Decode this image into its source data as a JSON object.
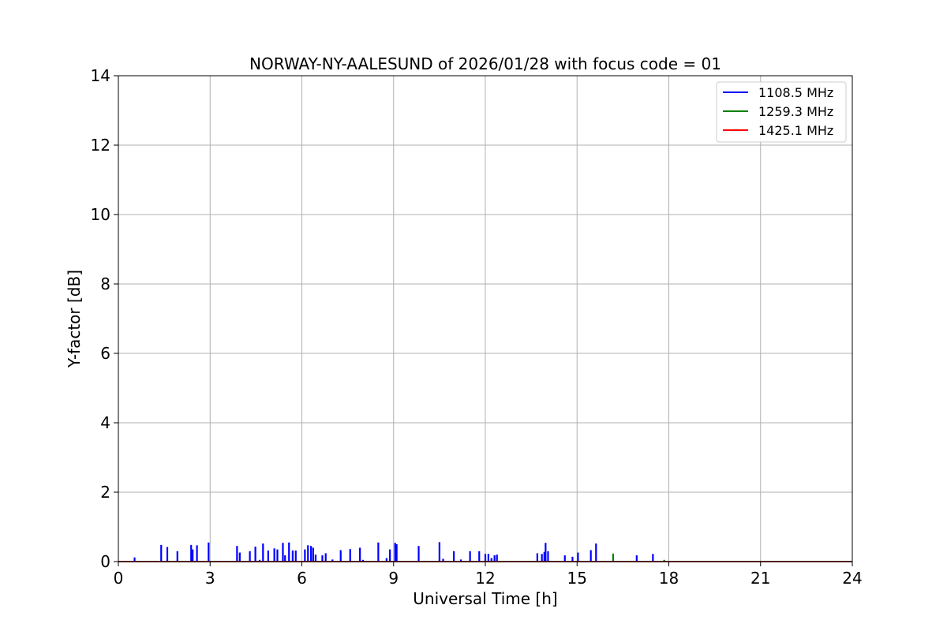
{
  "chart_data": {
    "type": "line",
    "title": "NORWAY-NY-AALESUND of 2026/01/28 with focus code = 01",
    "xlabel": "Universal Time [h]",
    "ylabel": "Y-factor [dB]",
    "xlim": [
      0,
      24
    ],
    "ylim": [
      0,
      14
    ],
    "xticks": [
      0,
      3,
      6,
      9,
      12,
      15,
      18,
      21,
      24
    ],
    "yticks": [
      0,
      2,
      4,
      6,
      8,
      10,
      12,
      14
    ],
    "grid": true,
    "legend_position": "top-right",
    "series": [
      {
        "name": "1108.5 MHz",
        "color": "#0000ff",
        "spikes": [
          [
            0.53,
            0.12
          ],
          [
            1.4,
            0.48
          ],
          [
            1.6,
            0.42
          ],
          [
            1.93,
            0.3
          ],
          [
            2.38,
            0.48
          ],
          [
            2.43,
            0.35
          ],
          [
            2.57,
            0.47
          ],
          [
            2.95,
            0.55
          ],
          [
            3.88,
            0.45
          ],
          [
            3.97,
            0.26
          ],
          [
            4.3,
            0.3
          ],
          [
            4.48,
            0.43
          ],
          [
            4.62,
            0.05
          ],
          [
            4.73,
            0.52
          ],
          [
            4.9,
            0.32
          ],
          [
            5.1,
            0.38
          ],
          [
            5.2,
            0.35
          ],
          [
            5.38,
            0.54
          ],
          [
            5.45,
            0.18
          ],
          [
            5.58,
            0.55
          ],
          [
            5.7,
            0.32
          ],
          [
            5.8,
            0.32
          ],
          [
            6.1,
            0.35
          ],
          [
            6.2,
            0.47
          ],
          [
            6.3,
            0.45
          ],
          [
            6.37,
            0.4
          ],
          [
            6.45,
            0.2
          ],
          [
            6.67,
            0.18
          ],
          [
            6.78,
            0.24
          ],
          [
            7.0,
            0.06
          ],
          [
            7.27,
            0.33
          ],
          [
            7.58,
            0.36
          ],
          [
            7.9,
            0.4
          ],
          [
            8.0,
            0.05
          ],
          [
            8.5,
            0.55
          ],
          [
            8.77,
            0.1
          ],
          [
            8.88,
            0.35
          ],
          [
            9.05,
            0.54
          ],
          [
            9.1,
            0.5
          ],
          [
            9.82,
            0.45
          ],
          [
            10.5,
            0.56
          ],
          [
            10.62,
            0.08
          ],
          [
            10.97,
            0.3
          ],
          [
            11.2,
            0.06
          ],
          [
            11.5,
            0.3
          ],
          [
            11.8,
            0.3
          ],
          [
            12.0,
            0.22
          ],
          [
            12.1,
            0.22
          ],
          [
            12.2,
            0.1
          ],
          [
            12.3,
            0.18
          ],
          [
            12.38,
            0.2
          ],
          [
            13.7,
            0.24
          ],
          [
            13.85,
            0.22
          ],
          [
            13.93,
            0.28
          ],
          [
            13.97,
            0.54
          ],
          [
            14.05,
            0.3
          ],
          [
            14.6,
            0.18
          ],
          [
            14.85,
            0.14
          ],
          [
            15.03,
            0.26
          ],
          [
            15.45,
            0.33
          ],
          [
            15.62,
            0.52
          ],
          [
            16.95,
            0.18
          ],
          [
            17.48,
            0.22
          ]
        ]
      },
      {
        "name": "1259.3 MHz",
        "color": "#008000",
        "spikes": [
          [
            16.18,
            0.23
          ],
          [
            17.85,
            0.05
          ]
        ]
      },
      {
        "name": "1425.1 MHz",
        "color": "#ff0000",
        "spikes": []
      }
    ]
  }
}
